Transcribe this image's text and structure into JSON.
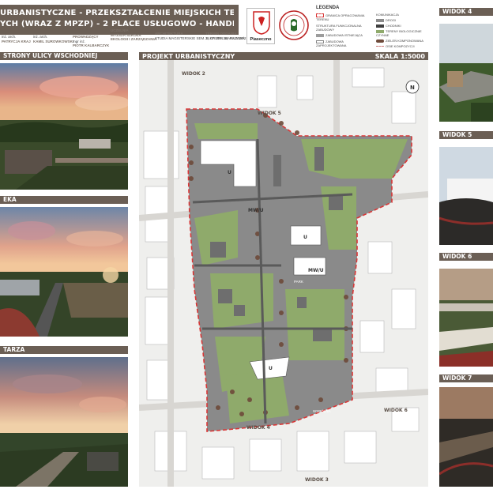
{
  "header": {
    "title_line1": "URBANISTYCZNE - PRZEKSZTAŁCENIE MIEJSKICH TERENÓW",
    "title_line2": "YCH (WRAZ Z MPZP) - 2 PLACE USŁUGOWO - HANDLOWE",
    "authors_label": "",
    "author1": "inż. arch.",
    "author1b": "PATRYCJA KRAJ",
    "author2": "inż. arch.",
    "author2b": "KAMIL SUROWKOWSKI",
    "supervisor_label": "PROWADZĄCY",
    "supervisor": "mgr inż.",
    "supervisor_b": "PIOTR KALBARCZYK",
    "school_label": "UCZELNIA",
    "school": "WYŻSZA SZKOŁA",
    "school_b": "EKOLOGII I ZARZĄDZANIA",
    "studies_label": "",
    "studies": "ARCHITEKTURA",
    "studies_b": "STUDIA MAGISTERSKIE",
    "studies_c": "SEM. II, GRUPA 2B, RA 2020/21",
    "date_label": "TERMIN ODDANIA",
    "date": "24.07.2021",
    "city": "WARSZAWA"
  },
  "logos": {
    "logo1_caption": "Piaseczno",
    "logo2_caption": ""
  },
  "legend": {
    "title": "LEGENDA",
    "items_left": [
      "GRANICA OPRACOWANIA TERENU",
      "STRUKTURA FUNKCJONALNA",
      "ZABUDOWY",
      "ZABUDOWA ISTNIEJĄCA",
      "ZABUDOWA ZAPROJEKTOWANA"
    ],
    "items_right": [
      "KOMUNIKACJA",
      "DROGI",
      "CHODNIKI",
      "TERENY BIOLOGICZNIE CZYNNE",
      "ZIELEŃ KOMPONOWANA",
      "OSIE KOMPOZYCJI"
    ],
    "colors": {
      "boundary": "#d93636",
      "existing": "#9c9c9c",
      "designed": "#ffffff",
      "green": "#8faa6b",
      "road": "#8a8a8a"
    }
  },
  "left_panels": [
    {
      "label": "STRONY ULICY WSCHODNIEJ"
    },
    {
      "label": "EKA"
    },
    {
      "label": "TARZA"
    }
  ],
  "right_panels": [
    {
      "label": "WIDOK 4"
    },
    {
      "label": "WIDOK 5"
    },
    {
      "label": "WIDOK 6"
    },
    {
      "label": "WIDOK 7"
    }
  ],
  "map": {
    "title": "PROJEKT URBANISTYCZNY",
    "scale": "SKALA 1:5000",
    "views": [
      "WIDOK 2",
      "WIDOK 5",
      "WIDOK 4",
      "WIDOK 3",
      "WIDOK 6"
    ],
    "tags": [
      "U",
      "MW/U",
      "U",
      "MW/U",
      "U"
    ],
    "streets": [
      "PARK",
      "WSCHODNIA",
      "WSPÓLNA",
      "SZKOLNA"
    ]
  }
}
